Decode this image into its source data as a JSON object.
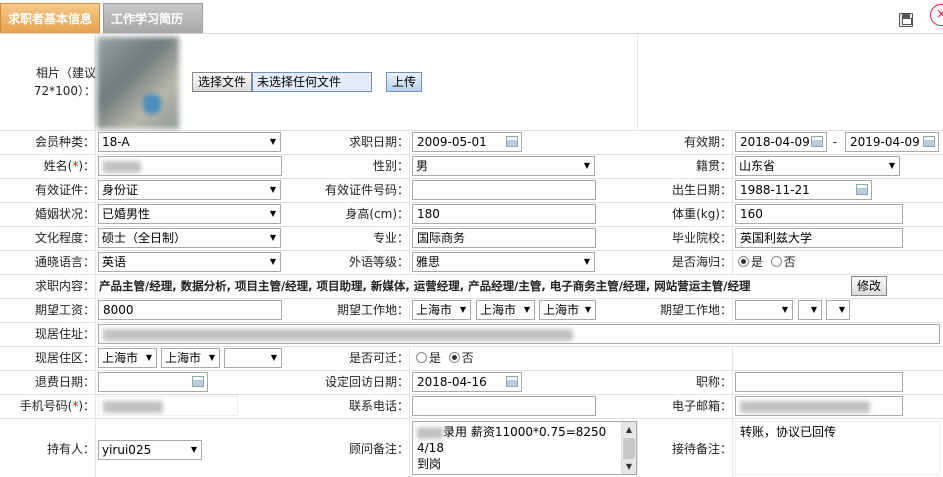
{
  "tabs": [
    {
      "label": "求职者基本信息"
    },
    {
      "label": "工作学习简历"
    }
  ],
  "photo": {
    "label": "相片（建议72*100）：",
    "choose_btn": "选择文件",
    "no_file": "未选择任何文件",
    "upload_btn": "上传"
  },
  "fields": {
    "member_type": {
      "label": "会员种类：",
      "value": "18-A"
    },
    "job_date": {
      "label": "求职日期：",
      "value": "2009-05-01"
    },
    "validity": {
      "label": "有效期：",
      "from": "2018-04-09",
      "sep": "-",
      "to": "2019-04-09"
    },
    "name": {
      "label_pre": "姓名(",
      "label_req": "*",
      "label_post": ")：",
      "value": ""
    },
    "gender": {
      "label": "性别：",
      "value": "男"
    },
    "native": {
      "label": "籍贯：",
      "value": "山东省"
    },
    "id_type": {
      "label": "有效证件：",
      "value": "身份证"
    },
    "id_no": {
      "label": "有效证件号码：",
      "value": ""
    },
    "birth": {
      "label": "出生日期：",
      "value": "1988-11-21"
    },
    "marital": {
      "label": "婚姻状况：",
      "value": "已婚男性"
    },
    "height": {
      "label": "身高(cm)：",
      "value": "180"
    },
    "weight": {
      "label": "体重(kg)：",
      "value": "160"
    },
    "education": {
      "label": "文化程度：",
      "value": "硕士（全日制）"
    },
    "major": {
      "label": "专业：",
      "value": "国际商务"
    },
    "school": {
      "label": "毕业院校：",
      "value": "英国利兹大学"
    },
    "language": {
      "label": "通晓语言：",
      "value": "英语"
    },
    "lang_level": {
      "label": "外语等级：",
      "value": "雅思"
    },
    "overseas": {
      "label": "是否海归：",
      "yes": "是",
      "no": "否"
    },
    "job_content": {
      "label": "求职内容：",
      "value": "产品主管/经理, 数据分析, 项目主管/经理, 项目助理, 新媒体, 运营经理, 产品经理/主管, 电子商务主管/经理, 网站营运主管/经理",
      "btn": "修改"
    },
    "salary": {
      "label": "期望工资：",
      "value": "8000"
    },
    "expect_place": {
      "label": "期望工作地：",
      "v1": "上海市",
      "v2": "上海市",
      "v3": "上海市"
    },
    "expect_place2": {
      "label": "期望工作地："
    },
    "address": {
      "label": "现居住址："
    },
    "area": {
      "label": "现居住区：",
      "v1": "上海市",
      "v2": "上海市"
    },
    "relocate": {
      "label": "是否可迁：",
      "yes": "是",
      "no": "否"
    },
    "refund_date": {
      "label": "退费日期：",
      "value": ""
    },
    "revisit": {
      "label": "设定回访日期：",
      "value": "2018-04-16"
    },
    "title": {
      "label": "职称：",
      "value": ""
    },
    "mobile": {
      "label_pre": "手机号码(",
      "label_req": "*",
      "label_post": ")："
    },
    "phone": {
      "label": "联系电话：",
      "value": ""
    },
    "email": {
      "label": "电子邮箱："
    },
    "holder": {
      "label": "持有人：",
      "value": "yirui025"
    },
    "advisor_note": {
      "label": "顾问备注：",
      "line1": "录用 薪资11000*0.75=8250 4/18",
      "line2": "到岗"
    },
    "reception_note": {
      "label": "接待备注：",
      "value": "转账，协议已回传"
    }
  }
}
